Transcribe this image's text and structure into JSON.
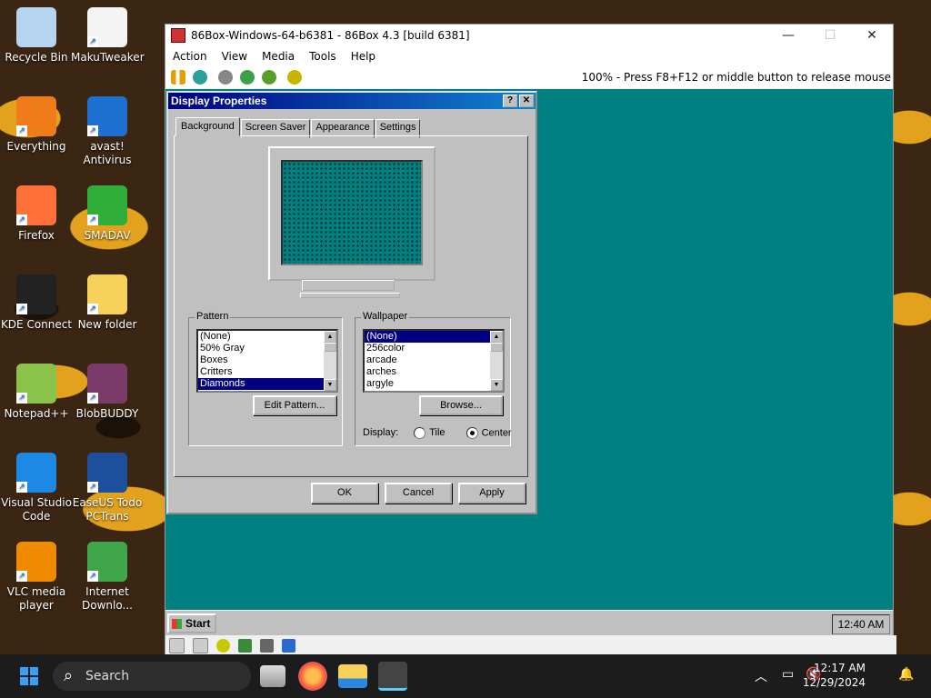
{
  "desktop_icons": [
    {
      "label": "Recycle Bin",
      "icon": "recycle-bin-icon",
      "color": "#b7d4ef"
    },
    {
      "label": "MakuTweaker",
      "icon": "document-icon",
      "color": "#f4f4f4"
    },
    {
      "label": "Everything",
      "icon": "search-ring-icon",
      "color": "#f07b19"
    },
    {
      "label": "avast! Antivirus",
      "icon": "avast-icon",
      "color": "#1f6fd1"
    },
    {
      "label": "Firefox",
      "icon": "firefox-icon",
      "color": "#ff7139"
    },
    {
      "label": "SMADAV",
      "icon": "smadav-icon",
      "color": "#2fae3a"
    },
    {
      "label": "KDE Connect",
      "icon": "phone-icon",
      "color": "#222222"
    },
    {
      "label": "New folder",
      "icon": "folder-icon",
      "color": "#f6d25b"
    },
    {
      "label": "Notepad++",
      "icon": "notepadpp-icon",
      "color": "#8bc34a"
    },
    {
      "label": "BlobBUDDY",
      "icon": "blob-icon",
      "color": "#7a3b6a"
    },
    {
      "label": "Visual Studio Code",
      "icon": "vscode-icon",
      "color": "#1e88e5"
    },
    {
      "label": "EaseUS Todo PCTrans",
      "icon": "easeus-icon",
      "color": "#1d4f9c"
    },
    {
      "label": "VLC media player",
      "icon": "vlc-icon",
      "color": "#f08a00"
    },
    {
      "label": "Internet Downlo...",
      "icon": "idm-icon",
      "color": "#3fa64a"
    }
  ],
  "box86": {
    "title": "86Box-Windows-64-b6381 - 86Box 4.3 [build 6381]",
    "menu": [
      "Action",
      "View",
      "Media",
      "Tools",
      "Help"
    ],
    "status_text": "100% - Press F8+F12 or middle button to release mouse"
  },
  "dialog": {
    "title": "Display Properties",
    "tabs": [
      "Background",
      "Screen Saver",
      "Appearance",
      "Settings"
    ],
    "pattern_label": "Pattern",
    "pattern_items": [
      "(None)",
      "50% Gray",
      "Boxes",
      "Critters",
      "Diamonds"
    ],
    "pattern_selected": "Diamonds",
    "edit_pattern_label": "Edit Pattern...",
    "wallpaper_label": "Wallpaper",
    "wallpaper_items": [
      "(None)",
      "256color",
      "arcade",
      "arches",
      "argyle"
    ],
    "wallpaper_selected": "(None)",
    "browse_label": "Browse...",
    "display_label": "Display:",
    "tile_label": "Tile",
    "center_label": "Center",
    "display_mode": "Center",
    "ok_label": "OK",
    "cancel_label": "Cancel",
    "apply_label": "Apply"
  },
  "vm_taskbar": {
    "start_label": "Start",
    "clock": "12:40 AM"
  },
  "taskbar": {
    "search_placeholder": "Search",
    "time": "12:17 AM",
    "date": "12/29/2024"
  }
}
